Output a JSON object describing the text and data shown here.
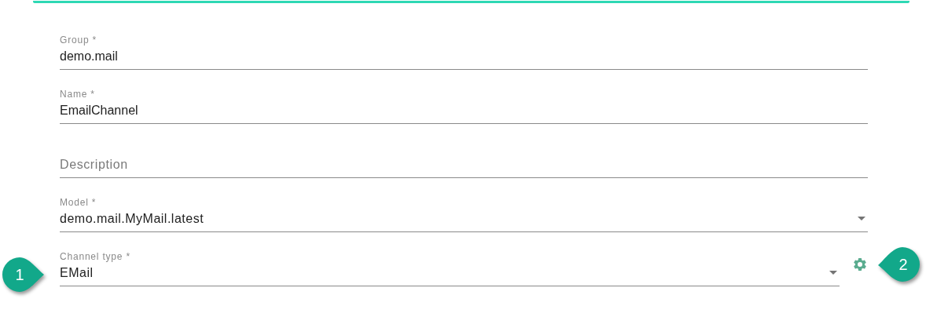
{
  "fields": [
    {
      "kind": "text",
      "label": "Group *",
      "value": "demo.mail"
    },
    {
      "kind": "text",
      "label": "Name *",
      "value": "EmailChannel"
    },
    {
      "kind": "empty",
      "placeholder": "Description"
    },
    {
      "kind": "select",
      "label": "Model *",
      "value": "demo.mail.MyMail.latest"
    },
    {
      "kind": "select",
      "label": "Channel type *",
      "value": "EMail",
      "settings": true
    }
  ],
  "callouts": [
    {
      "label": "1",
      "kind": "right"
    },
    {
      "label": "2",
      "kind": "left"
    }
  ]
}
